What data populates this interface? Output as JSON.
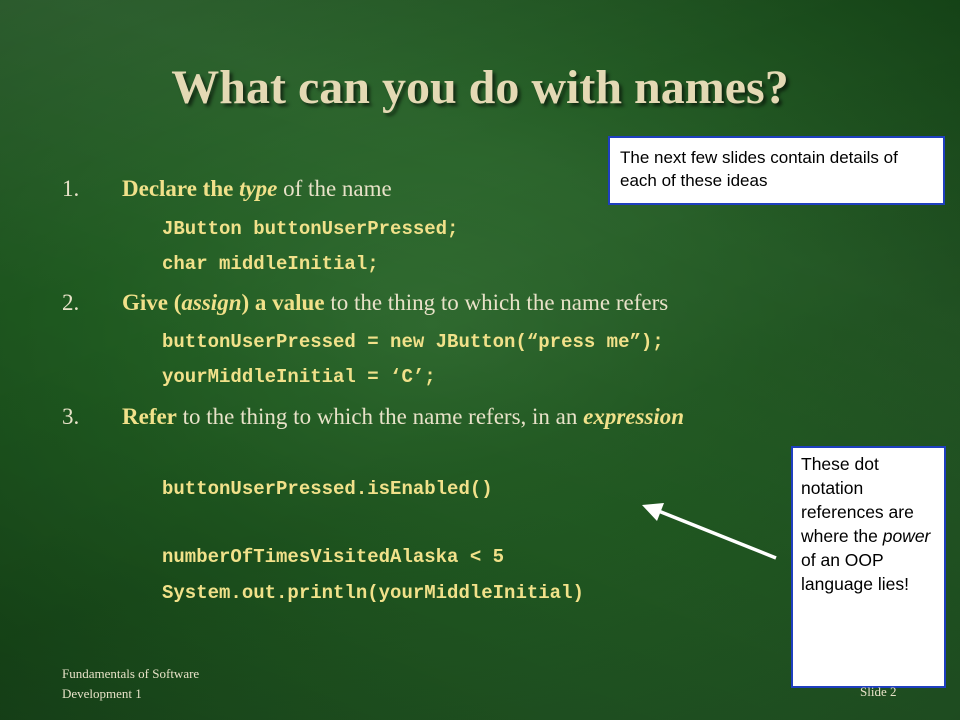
{
  "slide": {
    "title": "What can you do with names?",
    "items": [
      {
        "number": "1.",
        "lead_bold": "Declare the ",
        "lead_italic": "type",
        "rest": " of the name",
        "code": [
          "JButton buttonUserPressed;",
          "char middleInitial;"
        ]
      },
      {
        "number": "2.",
        "lead_bold": "Give (",
        "lead_italic": "assign",
        "lead_bold2": ") a value",
        "rest": " to the thing to which the name refers",
        "code": [
          "buttonUserPressed = new JButton(“press me”);",
          "yourMiddleInitial = ‘C’;"
        ]
      },
      {
        "number": "3.",
        "lead_bold": "Refer",
        "rest": " to the thing to which the name refers, in an ",
        "trail_italic": "expression",
        "code": [
          "buttonUserPressed.isEnabled()",
          "numberOfTimesVisitedAlaska < 5",
          "System.out.println(yourMiddleInitial)"
        ]
      }
    ],
    "callout_top": "The next few slides contain details of each of these ideas",
    "callout_side": {
      "before": "These dot notation references are where the ",
      "italic": "power",
      "after": " of an OOP language lies!"
    },
    "footer_left": [
      "Fundamentals of Software",
      "Development 1"
    ],
    "footer_right": "Slide 2"
  },
  "colors": {
    "background": "#1f5a20",
    "title": "#e4d9b4",
    "highlight": "#f1e18a",
    "body_text": "#e8e2c8",
    "callout_border": "#1f3fbf"
  }
}
